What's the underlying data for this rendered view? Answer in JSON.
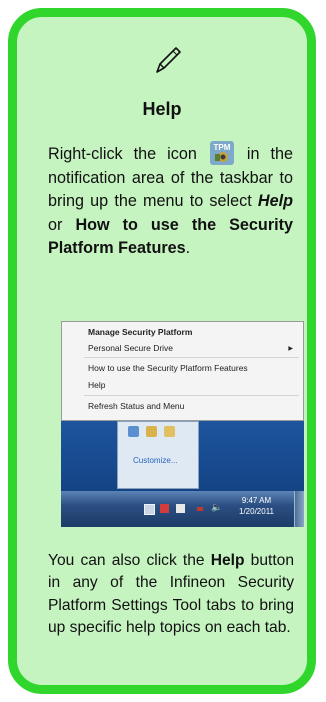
{
  "card": {
    "title": "Help",
    "icon": "pen-icon",
    "para1": {
      "t1": "Right-click the icon",
      "t2": "in the notification area of the taskbar to bring up the menu to select",
      "help": "Help",
      "or": "or",
      "how": "How to use the Security Platform Features",
      "end": "."
    },
    "para2": {
      "t1": "You can also click the",
      "help": "Help",
      "t2": "button in any of the Infineon Security Platform Settings Tool tabs to bring up specific help topics on each tab."
    }
  },
  "tpm_icon": {
    "label": "TPM",
    "name": "tpm-icon"
  },
  "screenshot": {
    "menu_items": [
      "Manage Security Platform",
      "Personal Secure Drive",
      "How to use the Security Platform Features",
      "Help",
      "Refresh Status and Menu"
    ],
    "customize": "Customize...",
    "clock_time": "9:47 AM",
    "clock_date": "1/20/2011"
  },
  "colors": {
    "border": "#31d62c",
    "panel": "#c6f4c1"
  }
}
